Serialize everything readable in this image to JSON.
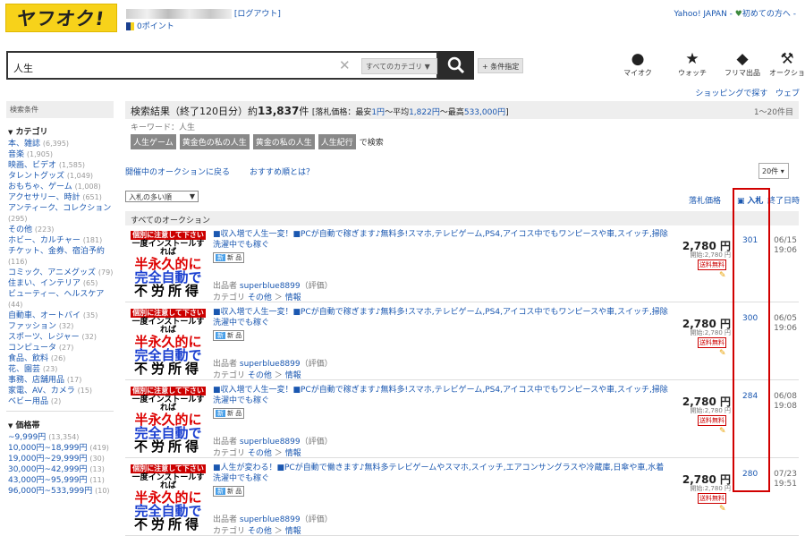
{
  "logo": {
    "text": "ヤフオク!"
  },
  "header": {
    "logout": "[ログアウト]",
    "points": "0ポイント",
    "yahoo": "Yahoo! JAPAN",
    "first": "初めての方へ"
  },
  "search": {
    "query": "人生",
    "category": "すべてのカテゴリ",
    "advanced": "+ 条件指定"
  },
  "nav": [
    {
      "label": "マイオク",
      "icon": "user-icon"
    },
    {
      "label": "ウォッチ",
      "icon": "star-icon"
    },
    {
      "label": "フリマ出品",
      "icon": "tag-icon"
    },
    {
      "label": "オークショ",
      "icon": "gavel-icon"
    }
  ],
  "shop_links": {
    "a": "ショッピングで探す",
    "b": "ウェブ"
  },
  "sidebar": {
    "title": "検索条件",
    "cat_title": "カテゴリ",
    "categories": [
      {
        "name": "本、雑誌",
        "count": "(6,395)"
      },
      {
        "name": "音楽",
        "count": "(1,905)"
      },
      {
        "name": "映画、ビデオ",
        "count": "(1,585)"
      },
      {
        "name": "タレントグッズ",
        "count": "(1,049)"
      },
      {
        "name": "おもちゃ、ゲーム",
        "count": "(1,008)"
      },
      {
        "name": "アクセサリー、時計",
        "count": "(651)"
      },
      {
        "name": "アンティーク、コレクション",
        "count": "(295)"
      },
      {
        "name": "その他",
        "count": "(223)"
      },
      {
        "name": "ホビー、カルチャー",
        "count": "(181)"
      },
      {
        "name": "チケット、金券、宿泊予約",
        "count": "(116)"
      },
      {
        "name": "コミック、アニメグッズ",
        "count": "(79)"
      },
      {
        "name": "住まい、インテリア",
        "count": "(65)"
      },
      {
        "name": "ビューティー、ヘルスケア",
        "count": "(44)"
      },
      {
        "name": "自動車、オートバイ",
        "count": "(35)"
      },
      {
        "name": "ファッション",
        "count": "(32)"
      },
      {
        "name": "スポーツ、レジャー",
        "count": "(32)"
      },
      {
        "name": "コンピュータ",
        "count": "(27)"
      },
      {
        "name": "食品、飲料",
        "count": "(26)"
      },
      {
        "name": "花、園芸",
        "count": "(23)"
      },
      {
        "name": "事務、店舗用品",
        "count": "(17)"
      },
      {
        "name": "家電、AV、カメラ",
        "count": "(15)"
      },
      {
        "name": "ベビー用品",
        "count": "(2)"
      }
    ],
    "price_title": "価格帯",
    "prices": [
      {
        "name": "~9,999円",
        "count": "(13,354)"
      },
      {
        "name": "10,000円~18,999円",
        "count": "(419)"
      },
      {
        "name": "19,000円~29,999円",
        "count": "(30)"
      },
      {
        "name": "30,000円~42,999円",
        "count": "(13)"
      },
      {
        "name": "43,000円~95,999円",
        "count": "(11)"
      },
      {
        "name": "96,000円~533,999円",
        "count": "(10)"
      }
    ]
  },
  "results": {
    "label": "検索結果（終了120日分）約",
    "count": "13,837",
    "suffix": "件",
    "price_range_pre": "[落札価格：最安",
    "min": "1円",
    "avg_pre": "～平均",
    "avg": "1,822円",
    "max_pre": "～最高",
    "max": "533,000円",
    "close": "]",
    "pages": "1～20件目",
    "keyword": "キーワード：人生",
    "tags": [
      "人生ゲーム",
      "黄金色の私の人生",
      "黄金の私の人生",
      "人生紀行"
    ],
    "tags_suffix": "で検索",
    "link1": "開催中のオークションに戻る",
    "link2": "おすすめ順とは？",
    "per_page": "20件",
    "sort": "入札の多い順",
    "col_price": "落札価格",
    "col_bids": "入札",
    "col_end": "終了日時",
    "section": "すべてのオークション"
  },
  "items": [
    {
      "title": "■収入増で人生一変！■PCが自動で稼ぎます♪無料多!スマホ,テレビゲーム,PS4,アイコス中でもワンピースや車,スイッチ,掃除洗濯中でも稼ぐ",
      "price": "2,780 円",
      "start": "開始:2,780 円",
      "bids": "301",
      "date": "06/15",
      "time": "19:06"
    },
    {
      "title": "■収入増で人生一変！■PCが自動で稼ぎます♪無料多!スマホ,テレビゲーム,PS4,アイコス中でもワンピースや車,スイッチ,掃除洗濯中でも稼ぐ",
      "price": "2,780 円",
      "start": "開始:2,780 円",
      "bids": "300",
      "date": "06/05",
      "time": "19:06"
    },
    {
      "title": "■収入増で人生一変！■PCが自動で稼ぎます♪無料多!スマホ,テレビゲーム,PS4,アイコス中でもワンピースや車,スイッチ,掃除洗濯中でも稼ぐ",
      "price": "2,780 円",
      "start": "開始:2,780 円",
      "bids": "284",
      "date": "06/08",
      "time": "19:08"
    },
    {
      "title": "■人生が変わる！■PCが自動で働きます♪無料多テレビゲームやスマホ,スイッチ,エアコンサングラスや冷蔵庫,日傘や車,水着洗濯中でも稼ぐ",
      "price": "2,780 円",
      "start": "開始:2,780 円",
      "bids": "280",
      "date": "07/23",
      "time": "19:51"
    }
  ],
  "item_common": {
    "new": "新 品",
    "seller_pre": "出品者",
    "seller": "superblue8899",
    "rating": "（評価）",
    "cat_pre": "カテゴリ",
    "cat1": "その他",
    "cat2": "情報",
    "ship": "送料無料",
    "thumb": {
      "a": "個別に注意して下さい",
      "b": "一度インストールすれば",
      "c": "半永久的に",
      "d": "完全自動で",
      "e": "不労所得"
    }
  },
  "colors": {
    "logo": "#f7d21a",
    "link": "#1a57b0",
    "highlight": "#d10000"
  }
}
